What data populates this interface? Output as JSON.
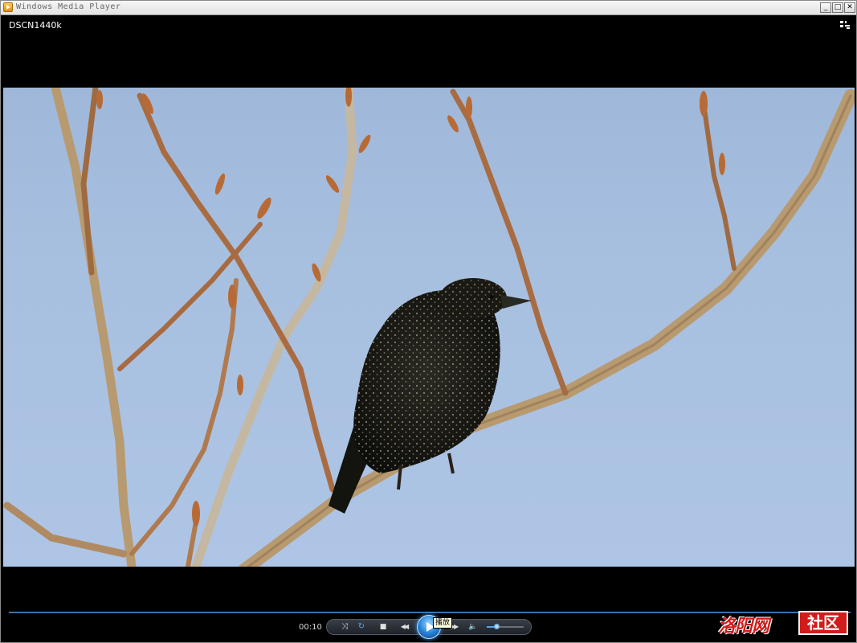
{
  "window": {
    "title": "Windows Media Player",
    "minimize_label": "_",
    "maximize_label": "□",
    "close_label": "✕"
  },
  "media": {
    "title": "DSCN1440k"
  },
  "playback": {
    "elapsed": "00:10",
    "volume_level": 0.25,
    "play_tooltip": "播放"
  },
  "controls": {
    "shuffle_glyph": "⤨",
    "repeat_glyph": "↻",
    "stop_glyph": "■",
    "previous_glyph": "◀◀",
    "next_glyph": "▶▶",
    "mute_glyph": "🔈"
  },
  "watermark": {
    "left_text": "洛阳网",
    "right_text": "社区"
  },
  "icons": {
    "app": "media-player-icon",
    "view_switch": "switch-to-library-icon"
  },
  "colors": {
    "sky": "#a8c0e0",
    "seek_bar": "#3f6ea8",
    "accent": "#2a86d8",
    "watermark_red": "#d21b1b"
  }
}
